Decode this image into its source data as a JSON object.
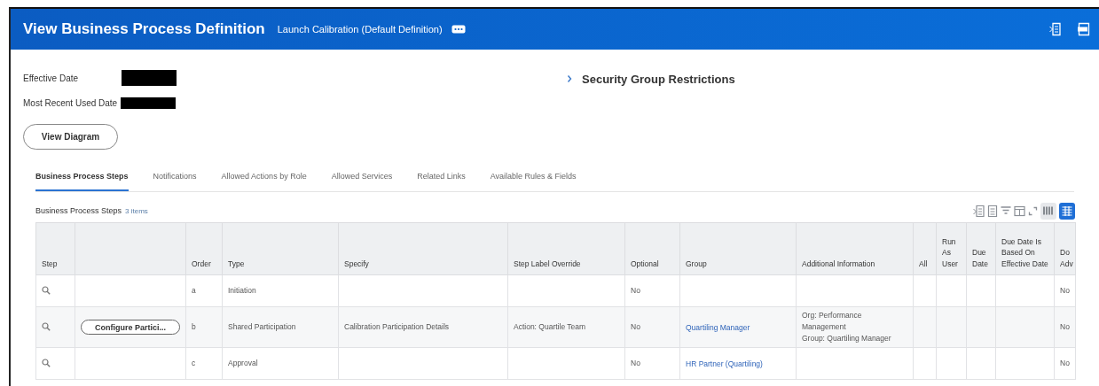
{
  "header": {
    "title": "View Business Process Definition",
    "subtitle": "Launch Calibration (Default Definition)"
  },
  "fields": [
    {
      "label": "Effective Date",
      "redacted": true
    },
    {
      "label": "Most Recent Used Date",
      "redacted": true
    }
  ],
  "view_diagram_button": "View Diagram",
  "section": {
    "title": "Security Group Restrictions",
    "expanded": false
  },
  "tabs": [
    {
      "label": "Business Process Steps",
      "selected": true
    },
    {
      "label": "Notifications",
      "selected": false
    },
    {
      "label": "Allowed Actions by Role",
      "selected": false
    },
    {
      "label": "Allowed Services",
      "selected": false
    },
    {
      "label": "Related Links",
      "selected": false
    },
    {
      "label": "Available Rules & Fields",
      "selected": false
    }
  ],
  "table": {
    "title": "Business Process Steps",
    "count": "3 items",
    "views": [
      {
        "kind": "grid",
        "selected": false
      },
      {
        "kind": "table",
        "selected": true
      }
    ],
    "columns": [
      "Step",
      "",
      "Order",
      "Type",
      "Specify",
      "Step Label Override",
      "Optional",
      "Group",
      "Additional Information",
      "All",
      "Run As User",
      "Due Date",
      "Due Date Is Based On Effective Date",
      "Do Adv"
    ],
    "rows": [
      [
        {
          "kind": "search"
        },
        {
          "kind": "empty"
        },
        {
          "kind": "text",
          "text": "a"
        },
        {
          "kind": "text",
          "text": "Initiation"
        },
        {
          "kind": "empty"
        },
        {
          "kind": "empty"
        },
        {
          "kind": "text",
          "text": "No"
        },
        {
          "kind": "empty"
        },
        {
          "kind": "empty"
        },
        {
          "kind": "empty"
        },
        {
          "kind": "empty"
        },
        {
          "kind": "empty"
        },
        {
          "kind": "empty"
        },
        {
          "kind": "text",
          "text": "No"
        }
      ],
      [
        {
          "kind": "search"
        },
        {
          "kind": "button",
          "text": "Configure Partici..."
        },
        {
          "kind": "text",
          "text": "b"
        },
        {
          "kind": "text",
          "text": "Shared Participation"
        },
        {
          "kind": "text",
          "text": "Calibration Participation Details"
        },
        {
          "kind": "text",
          "text": "Action: Quartile Team"
        },
        {
          "kind": "text",
          "text": "No"
        },
        {
          "kind": "link",
          "text": "Quartiling Manager"
        },
        {
          "kind": "lines",
          "lines": [
            "Org: Performance Management",
            "Group: Quartiling Manager"
          ]
        },
        {
          "kind": "empty"
        },
        {
          "kind": "empty"
        },
        {
          "kind": "empty"
        },
        {
          "kind": "empty"
        },
        {
          "kind": "text",
          "text": "No"
        }
      ],
      [
        {
          "kind": "search"
        },
        {
          "kind": "empty"
        },
        {
          "kind": "text",
          "text": "c"
        },
        {
          "kind": "text",
          "text": "Approval"
        },
        {
          "kind": "empty"
        },
        {
          "kind": "empty"
        },
        {
          "kind": "text",
          "text": "No"
        },
        {
          "kind": "link",
          "text": "HR Partner (Quartiling)"
        },
        {
          "kind": "empty"
        },
        {
          "kind": "empty"
        },
        {
          "kind": "empty"
        },
        {
          "kind": "empty"
        },
        {
          "kind": "empty"
        },
        {
          "kind": "text",
          "text": "No"
        }
      ]
    ]
  }
}
